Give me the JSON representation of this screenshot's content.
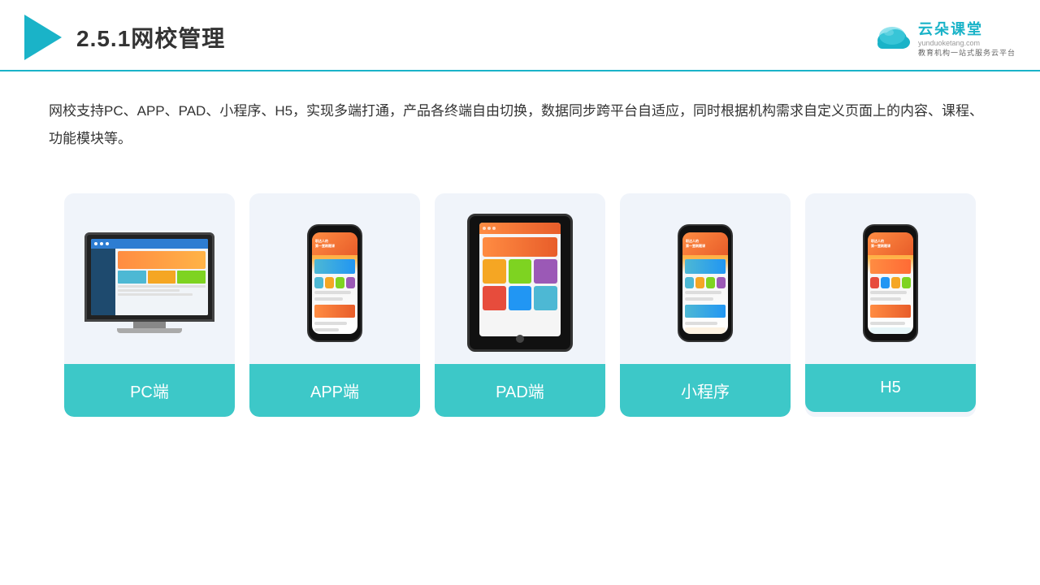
{
  "header": {
    "title": "2.5.1网校管理",
    "brand": {
      "name": "云朵课堂",
      "url": "yunduoketang.com",
      "sub": "教育机构一站\n式服务云平台"
    }
  },
  "description": "网校支持PC、APP、PAD、小程序、H5，实现多端打通，产品各终端自由切换，数据同步跨平台自适应，同时根据机构需求自定义页面上的内容、课程、功能模块等。",
  "cards": [
    {
      "id": "pc",
      "label": "PC端"
    },
    {
      "id": "app",
      "label": "APP端"
    },
    {
      "id": "pad",
      "label": "PAD端"
    },
    {
      "id": "miniprogram",
      "label": "小程序"
    },
    {
      "id": "h5",
      "label": "H5"
    }
  ],
  "colors": {
    "accent": "#1ab3c8",
    "card_bg": "#f0f4fa",
    "label_bg": "#3dc8c8",
    "label_text": "#ffffff"
  }
}
